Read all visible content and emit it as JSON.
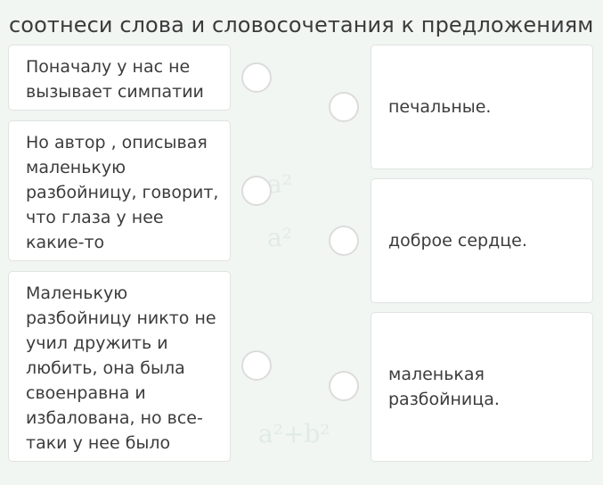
{
  "title": "соотнеси слова и словосочетания к предложениям",
  "left_items": [
    {
      "text": "Поначалу у нас не вызывает симпатии"
    },
    {
      "text": "Но автор , описывая маленькую разбойницу, говорит, что глаза у нее какие-то"
    },
    {
      "text": "Маленькую разбойницу никто не учил дружить и любить, она была своенравна и избалована, но все-таки у нее было"
    }
  ],
  "right_items": [
    {
      "text": "печальные."
    },
    {
      "text": "доброе сердце."
    },
    {
      "text": "маленькая разбойница."
    }
  ],
  "colors": {
    "background": "#f1f6f3",
    "card_border": "#dfe3e1",
    "radio_border": "#dcdcdc"
  }
}
